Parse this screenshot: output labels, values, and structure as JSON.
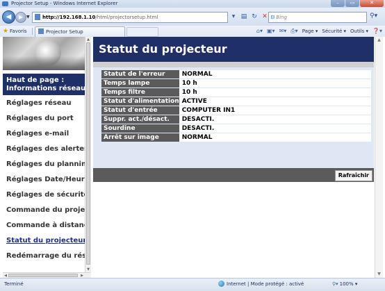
{
  "window": {
    "title": "Projector Setup - Windows Internet Explorer",
    "buttons": {
      "minimize": "–",
      "maximize": "▭",
      "close": "✕"
    }
  },
  "address": {
    "url_host": "http://192.168.1.10",
    "url_path": "/html/projectorsetup.html",
    "search_placeholder": "Bing",
    "search_brand": "ᗷ"
  },
  "favorites": {
    "label": "Favoris",
    "tab_title": "Projector Setup",
    "commands": {
      "page": "Page ▾",
      "security": "Sécurité ▾",
      "tools": "Outils ▾",
      "help": "❓▾"
    }
  },
  "sidebar": {
    "active_label": "Haut de page : Informations réseau",
    "items": [
      {
        "label": "Réglages réseau"
      },
      {
        "label": "Réglages du port"
      },
      {
        "label": "Réglages e-mail"
      },
      {
        "label": "Réglages des alertes"
      },
      {
        "label": "Réglages du planning"
      },
      {
        "label": "Réglages Date/Heure"
      },
      {
        "label": "Réglages de sécurité"
      },
      {
        "label": "Commande du projecteur"
      },
      {
        "label": "Commande à distance"
      },
      {
        "label": "Statut du projecteur"
      },
      {
        "label": "Redémarrage du réseau"
      }
    ]
  },
  "main": {
    "title": "Statut du projecteur",
    "status_rows": [
      {
        "label": "Statut de l'erreur",
        "value": "NORMAL"
      },
      {
        "label": "Temps lampe",
        "value": "10 h"
      },
      {
        "label": "Temps filtre",
        "value": "10 h"
      },
      {
        "label": "Statut d'alimentation",
        "value": "ACTIVE"
      },
      {
        "label": "Statut d'entrée",
        "value": "COMPUTER IN1"
      },
      {
        "label": "Suppr. act./désact.",
        "value": "DESACTI."
      },
      {
        "label": "Sourdine",
        "value": "DESACTI."
      },
      {
        "label": "Arrêt sur image",
        "value": "NORMAL"
      }
    ],
    "refresh_label": "Rafraîchir"
  },
  "statusbar": {
    "left": "Terminé",
    "zone": "Internet | Mode protégé : activé",
    "zoom": "100%"
  },
  "colors": {
    "nav_dark": "#1f2f68",
    "label_gray": "#5a5a5a",
    "table_bg": "#dfe7f4"
  }
}
